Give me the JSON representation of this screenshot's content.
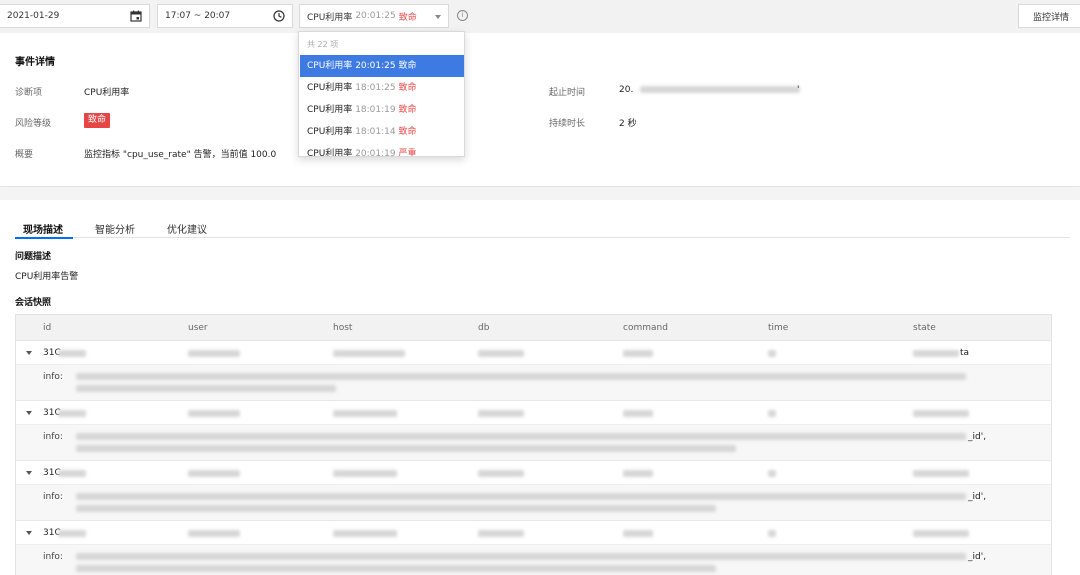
{
  "toolbar": {
    "date": "2021-01-29",
    "time_range": "17:07 ~ 20:07",
    "selected_event": {
      "name": "CPU利用率",
      "time": "20:01:25",
      "level": "致命"
    },
    "monitor_button": "监控详情"
  },
  "dropdown": {
    "header": "共 22 项",
    "items": [
      {
        "name": "CPU利用率",
        "time": "20:01:25",
        "level": "致命"
      },
      {
        "name": "CPU利用率",
        "time": "18:01:25",
        "level": "致命"
      },
      {
        "name": "CPU利用率",
        "time": "18:01:19",
        "level": "致命"
      },
      {
        "name": "CPU利用率",
        "time": "18:01:14",
        "level": "致命"
      },
      {
        "name": "CPU利用率",
        "time": "20:01:19",
        "level": "严重"
      }
    ]
  },
  "detail": {
    "title": "事件详情",
    "diagnosis_label": "诊断项",
    "diagnosis_value": "CPU利用率",
    "risk_label": "风险等级",
    "risk_value": "致命",
    "summary_label": "概要",
    "summary_value": "监控指标 \"cpu_use_rate\" 告警，当前值 100.0",
    "time_label": "起止时间",
    "time_value_prefix": "20.",
    "time_value_suffix": "'",
    "duration_label": "持续时长",
    "duration_value": "2 秒"
  },
  "tabs": [
    {
      "label": "现场描述",
      "active": true
    },
    {
      "label": "智能分析",
      "active": false
    },
    {
      "label": "优化建议",
      "active": false
    }
  ],
  "problem": {
    "title": "问题描述",
    "text": "CPU利用率告警"
  },
  "snapshot": {
    "title": "会话快照",
    "columns": [
      "id",
      "user",
      "host",
      "db",
      "command",
      "time",
      "state"
    ],
    "info_label": "info:",
    "rows": [
      {
        "id": "31C",
        "state_tail": "ta",
        "info_tail": ""
      },
      {
        "id": "31C",
        "state_tail": "",
        "info_tail": "_id',"
      },
      {
        "id": "31C",
        "state_tail": "",
        "info_tail": "_id',"
      },
      {
        "id": "31C",
        "state_tail": "",
        "info_tail": "_id',"
      }
    ]
  }
}
